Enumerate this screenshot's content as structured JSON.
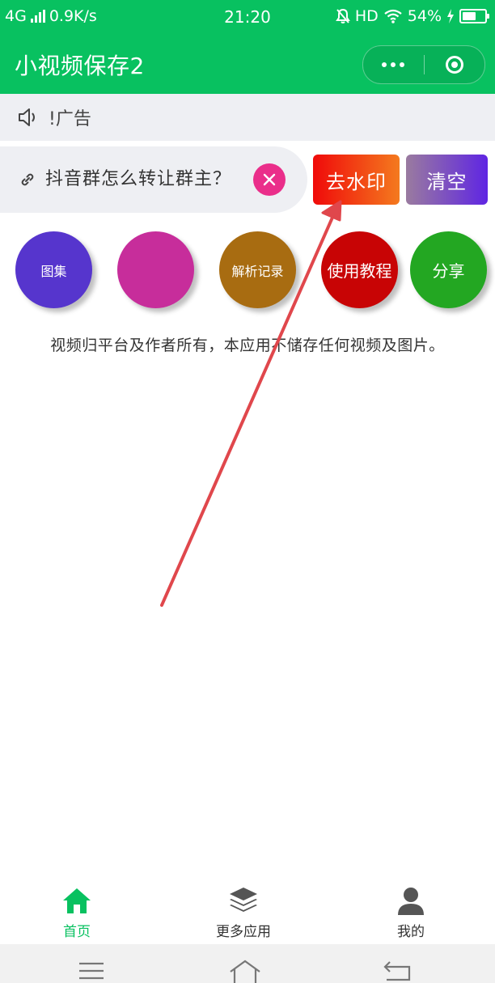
{
  "status_bar": {
    "network": "4G",
    "speed": "0.9K/s",
    "time": "21:20",
    "hd": "HD",
    "battery": "54%"
  },
  "header": {
    "title": "小视频保存2"
  },
  "notice": {
    "text": "!广告"
  },
  "input": {
    "value": "抖音群怎么转让群主？"
  },
  "buttons": {
    "remove_watermark": "去水印",
    "clear": "清空"
  },
  "circles": [
    {
      "label": "图集",
      "color": "#5635cd"
    },
    {
      "label": "",
      "color": "#c72d9b"
    },
    {
      "label": "解析记录",
      "color": "#a86c11"
    },
    {
      "label": "使用教程",
      "color": "#c80405"
    },
    {
      "label": "分享",
      "color": "#23a722"
    }
  ],
  "disclaimer": "视频归平台及作者所有，本应用不储存任何视频及图片。",
  "tabs": [
    {
      "label": "首页",
      "icon": "home-icon",
      "active": true
    },
    {
      "label": "更多应用",
      "icon": "layers-icon",
      "active": false
    },
    {
      "label": "我的",
      "icon": "user-icon",
      "active": false
    }
  ],
  "colors": {
    "brand": "#08c160",
    "tab_active": "#08c160",
    "tab_inactive": "#333333",
    "annotation_arrow": "#e0474c"
  }
}
